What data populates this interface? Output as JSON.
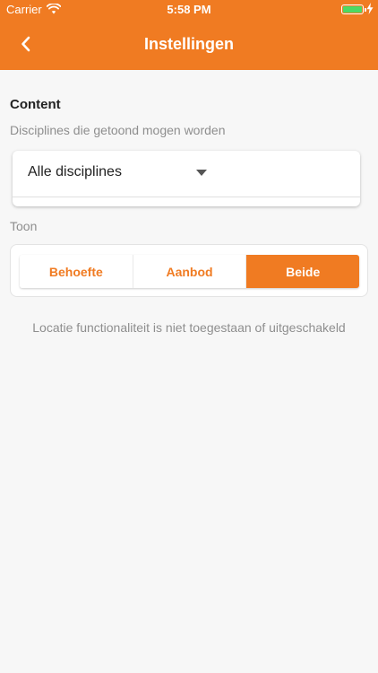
{
  "status": {
    "carrier": "Carrier",
    "time": "5:58 PM"
  },
  "header": {
    "title": "Instellingen"
  },
  "content": {
    "section_title": "Content",
    "disciplines_label": "Disciplines die getoond mogen worden",
    "disciplines_value": "Alle disciplines"
  },
  "toon": {
    "label": "Toon",
    "options": [
      "Behoefte",
      "Aanbod",
      "Beide"
    ],
    "selected": "Beide"
  },
  "notice": "Locatie functionaliteit is niet toegestaan of uitgeschakeld",
  "colors": {
    "accent": "#f07b22",
    "battery": "#4cd964"
  }
}
